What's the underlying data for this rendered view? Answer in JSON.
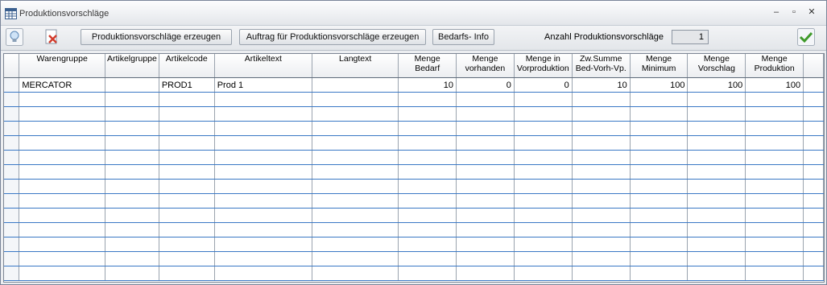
{
  "window": {
    "title": "Produktionsvorschläge"
  },
  "toolbar": {
    "generate_label": "Produktionsvorschläge erzeugen",
    "order_label": "Auftrag für Produktionsvorschläge erzeugen",
    "demand_info_label": "Bedarfs- Info",
    "count_label": "Anzahl Produktionsvorschläge",
    "count_value": "1"
  },
  "table": {
    "columns": [
      {
        "l1": "",
        "l2": ""
      },
      {
        "l1": "Warengruppe",
        "l2": ""
      },
      {
        "l1": "Artikelgruppe",
        "l2": ""
      },
      {
        "l1": "Artikelcode",
        "l2": ""
      },
      {
        "l1": "Artikeltext",
        "l2": ""
      },
      {
        "l1": "Langtext",
        "l2": ""
      },
      {
        "l1": "Menge",
        "l2": "Bedarf"
      },
      {
        "l1": "Menge",
        "l2": "vorhanden"
      },
      {
        "l1": "Menge in",
        "l2": "Vorproduktion"
      },
      {
        "l1": "Zw.Summe",
        "l2": "Bed-Vorh-Vp."
      },
      {
        "l1": "Menge",
        "l2": "Minimum"
      },
      {
        "l1": "Menge",
        "l2": "Vorschlag"
      },
      {
        "l1": "Menge",
        "l2": "Produktion"
      },
      {
        "l1": "",
        "l2": ""
      }
    ],
    "rows": [
      [
        "",
        "MERCATOR",
        "",
        "PROD1",
        "Prod 1",
        "",
        "10",
        "0",
        "0",
        "10",
        "100",
        "100",
        "100",
        ""
      ]
    ],
    "empty_rows": 13
  },
  "icons": {
    "app": "grid-table-icon",
    "lightbulb": "lightbulb-icon",
    "delete": "delete-document-icon",
    "ok": "checkmark-icon"
  }
}
